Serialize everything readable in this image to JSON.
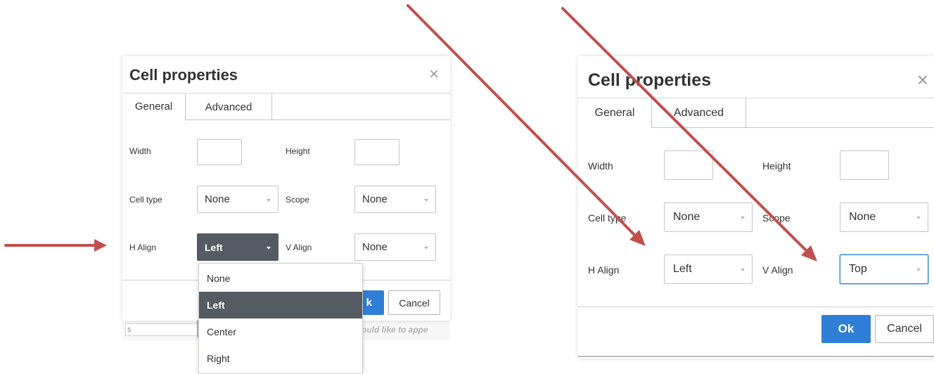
{
  "left_dialog": {
    "title": "Cell properties",
    "close_symbol": "×",
    "tabs": [
      {
        "label": "General",
        "active": true
      },
      {
        "label": "Advanced",
        "active": false
      }
    ],
    "fields": {
      "width_label": "Width",
      "height_label": "Height",
      "cell_type_label": "Cell type",
      "cell_type_value": "None",
      "scope_label": "Scope",
      "scope_value": "None",
      "h_align_label": "H Align",
      "h_align_value": "Left",
      "v_align_label": "V Align",
      "v_align_value": "None"
    },
    "buttons": {
      "ok_label_partial": "k",
      "cancel_label": "Cancel"
    },
    "dropdown_options": [
      {
        "label": "None",
        "selected": false
      },
      {
        "label": "Left",
        "selected": true
      },
      {
        "label": "Center",
        "selected": false
      },
      {
        "label": "Right",
        "selected": false
      }
    ],
    "underlay": {
      "input_text": "s",
      "hint_text": "ould like to appe"
    }
  },
  "right_dialog": {
    "title": "Cell properties",
    "close_symbol": "×",
    "tabs": [
      {
        "label": "General",
        "active": true
      },
      {
        "label": "Advanced",
        "active": false
      }
    ],
    "fields": {
      "width_label": "Width",
      "height_label": "Height",
      "cell_type_label": "Cell type",
      "cell_type_value": "None",
      "scope_label": "Scope",
      "scope_value": "None",
      "h_align_label": "H Align",
      "h_align_value": "Left",
      "v_align_label": "V Align",
      "v_align_value": "Top"
    },
    "buttons": {
      "ok_label": "Ok",
      "cancel_label": "Cancel"
    }
  },
  "colors": {
    "annotation_arrow": "#c0504d",
    "primary_button": "#2f7fd6",
    "selected_dark": "#545b62"
  }
}
